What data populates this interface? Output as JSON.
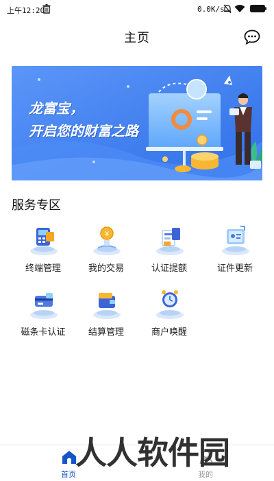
{
  "status_bar": {
    "time": "上午12:20",
    "network_speed": "0.0K/s"
  },
  "header": {
    "title": "主页",
    "chat_icon": "chat-bubble-icon"
  },
  "banner": {
    "line1": "龙富宝，",
    "line2": "开启您的财富之路",
    "colors": {
      "background": "#3b7ef6",
      "accent": "#f7b733"
    }
  },
  "services": {
    "title": "服务专区",
    "items": [
      {
        "label": "终端管理",
        "icon": "terminal-management-icon"
      },
      {
        "label": "我的交易",
        "icon": "my-transactions-icon"
      },
      {
        "label": "认证提额",
        "icon": "certification-limit-icon"
      },
      {
        "label": "证件更新",
        "icon": "document-update-icon"
      },
      {
        "label": "磁条卡认证",
        "icon": "magnetic-card-icon"
      },
      {
        "label": "结算管理",
        "icon": "settlement-management-icon"
      },
      {
        "label": "商户唤醒",
        "icon": "merchant-wakeup-icon"
      }
    ]
  },
  "tabbar": {
    "home": "首页",
    "mine": "我的",
    "active_color": "#1456c8"
  },
  "watermark": "人人软件园"
}
